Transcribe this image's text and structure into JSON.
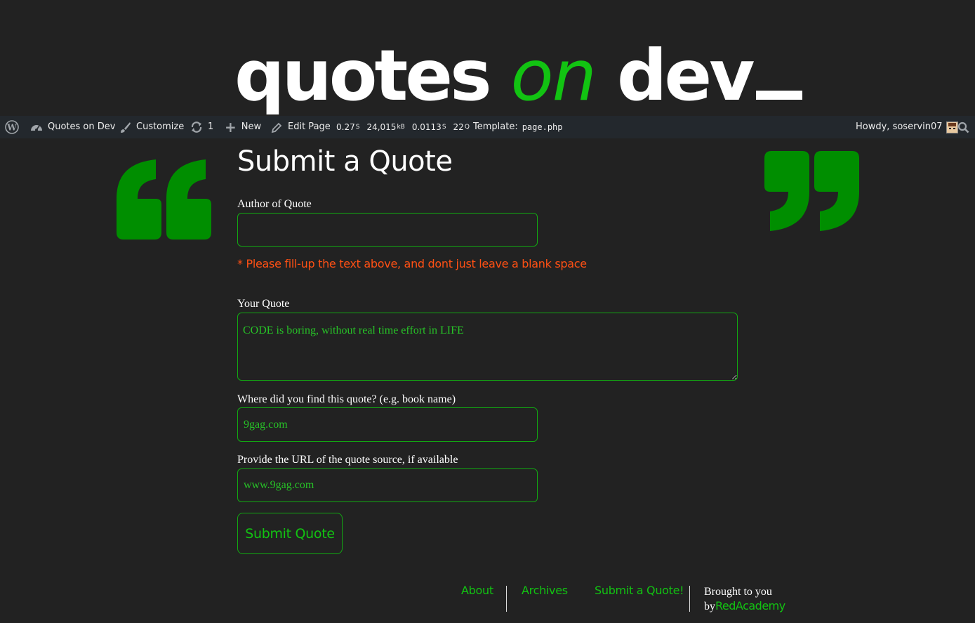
{
  "logo": {
    "part1": "quotes",
    "part2": "on",
    "part3": "dev"
  },
  "admin_bar": {
    "wp_icon": "wordpress-icon",
    "site_name": "Quotes on Dev",
    "customize": "Customize",
    "updates_count": "1",
    "new_label": "New",
    "edit_page": "Edit Page",
    "stats": {
      "time": "0.27",
      "time_unit": "S",
      "memory": "24,015",
      "memory_unit": "kB",
      "query_time": "0.0113",
      "query_time_unit": "S",
      "queries": "22",
      "queries_unit": "Q"
    },
    "template_label": "Template:",
    "template_file": "page.php",
    "howdy": "Howdy, soservin07",
    "search_icon": "search-icon"
  },
  "page": {
    "title": "Submit a Quote",
    "open_quote": "“",
    "close_quote": "”"
  },
  "form": {
    "author_label": "Author of Quote",
    "author_value": "",
    "error_message": "* Please fill-up the text above, and dont just leave a blank space",
    "quote_label": "Your Quote",
    "quote_value": "CODE is boring, without real time effort in LIFE",
    "source_label": "Where did you find this quote? (e.g. book name)",
    "source_value": "9gag.com",
    "url_label": "Provide the URL of the quote source, if available",
    "url_value": "www.9gag.com",
    "submit_label": "Submit Quote"
  },
  "footer": {
    "about": "About",
    "archives": "Archives",
    "submit": "Submit a Quote!",
    "credit_line1": "Brought to you",
    "credit_by": "by",
    "credit_link": "RedAcademy"
  },
  "colors": {
    "background": "#222222",
    "accent": "#12c312",
    "error": "#ff5014",
    "admin_bar": "#23282d"
  }
}
